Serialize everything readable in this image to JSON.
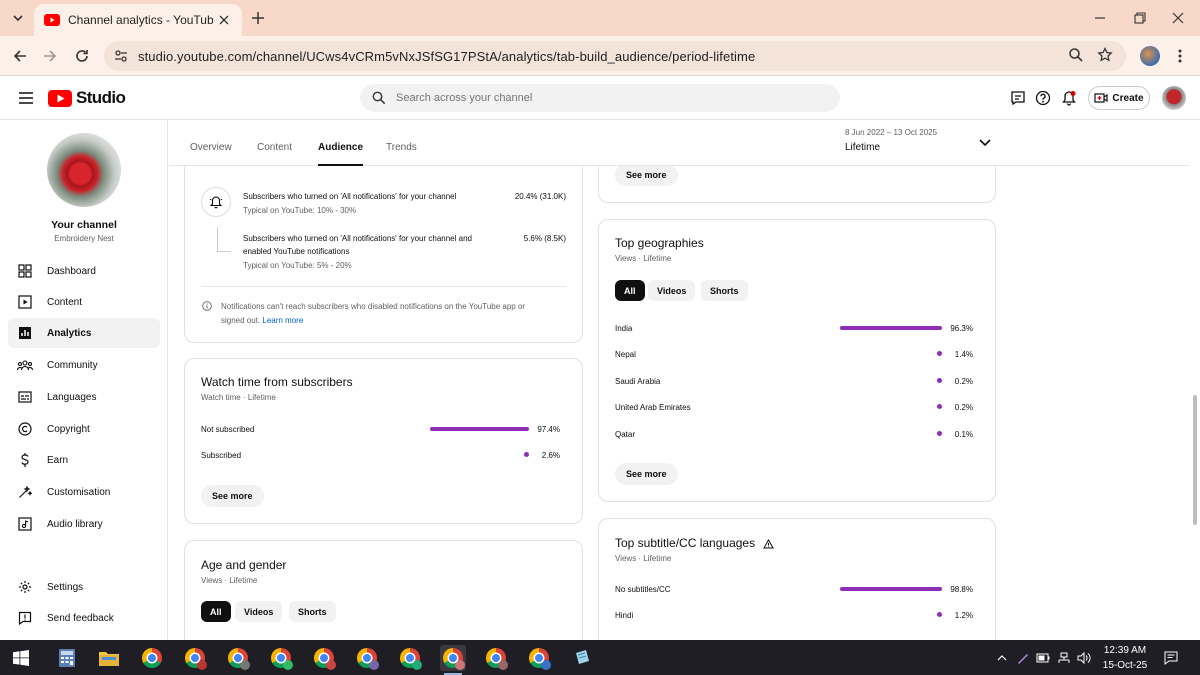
{
  "browser": {
    "tab_title": "Channel analytics - YouTube Studio",
    "url": "studio.youtube.com/channel/UCws4vCRm5vNxJSfSG17PStA/analytics/tab-build_audience/period-lifetime"
  },
  "header": {
    "logo_text": "Studio",
    "search_placeholder": "Search across your channel",
    "create_label": "Create"
  },
  "sidebar": {
    "channel_title": "Your channel",
    "channel_name": "Embroidery Nest",
    "items": [
      {
        "label": "Dashboard",
        "icon": "dashboard-icon"
      },
      {
        "label": "Content",
        "icon": "content-icon"
      },
      {
        "label": "Analytics",
        "icon": "analytics-icon",
        "active": true
      },
      {
        "label": "Community",
        "icon": "community-icon"
      },
      {
        "label": "Languages",
        "icon": "languages-icon"
      },
      {
        "label": "Copyright",
        "icon": "copyright-icon"
      },
      {
        "label": "Earn",
        "icon": "earn-icon"
      },
      {
        "label": "Customisation",
        "icon": "customisation-icon"
      },
      {
        "label": "Audio library",
        "icon": "audio-library-icon"
      },
      {
        "label": "Settings",
        "icon": "settings-icon"
      },
      {
        "label": "Send feedback",
        "icon": "feedback-icon"
      }
    ]
  },
  "tabs": [
    "Overview",
    "Content",
    "Audience",
    "Trends"
  ],
  "active_tab": "Audience",
  "period": {
    "range": "8 Jun 2022 – 13 Oct 2025",
    "label": "Lifetime"
  },
  "notifications_card": {
    "row1_text": "Subscribers who turned on 'All notifications' for your channel",
    "row1_typical": "Typical on YouTube: 10% - 30%",
    "row1_value": "20.4% (31.0K)",
    "row2_text_a": "Subscribers who turned on 'All notifications' for your channel and",
    "row2_text_b": "enabled YouTube notifications",
    "row2_typical": "Typical on YouTube: 5% - 20%",
    "row2_value": "5.6% (8.5K)",
    "footnote_a": "Notifications can't reach subscribers who disabled notifications on the YouTube app or",
    "footnote_b": "signed out.",
    "learn_more": "Learn more"
  },
  "watch_time_card": {
    "title": "Watch time from subscribers",
    "subtitle": "Watch time · Lifetime",
    "rows": [
      {
        "label": "Not subscribed",
        "value": "97.4%",
        "fraction": 0.974
      },
      {
        "label": "Subscribed",
        "value": "2.6%",
        "fraction": 0.026
      }
    ],
    "see_more": "See more"
  },
  "age_gender_card": {
    "title": "Age and gender",
    "subtitle": "Views · Lifetime",
    "chips": [
      "All",
      "Videos",
      "Shorts"
    ]
  },
  "top_card": {
    "see_more": "See more"
  },
  "geo_card": {
    "title": "Top geographies",
    "subtitle": "Views · Lifetime",
    "chips": [
      "All",
      "Videos",
      "Shorts"
    ],
    "rows": [
      {
        "label": "India",
        "value": "96.3%",
        "fraction": 0.963
      },
      {
        "label": "Nepal",
        "value": "1.4%",
        "fraction": 0.014
      },
      {
        "label": "Saudi Arabia",
        "value": "0.2%",
        "fraction": 0.002
      },
      {
        "label": "United Arab Emirates",
        "value": "0.2%",
        "fraction": 0.002
      },
      {
        "label": "Qatar",
        "value": "0.1%",
        "fraction": 0.001
      }
    ],
    "see_more": "See more"
  },
  "subtitle_card": {
    "title": "Top subtitle/CC languages",
    "subtitle": "Views · Lifetime",
    "rows": [
      {
        "label": "No subtitles/CC",
        "value": "98.8%",
        "fraction": 0.988
      },
      {
        "label": "Hindi",
        "value": "1.2%",
        "fraction": 0.012
      }
    ]
  },
  "taskbar": {
    "time": "12:39 AM",
    "date": "15-Oct-25"
  },
  "colors": {
    "accent": "#8e2eb8",
    "tab_strip": "#f8d9c9",
    "youtube_red": "#ff0000"
  }
}
